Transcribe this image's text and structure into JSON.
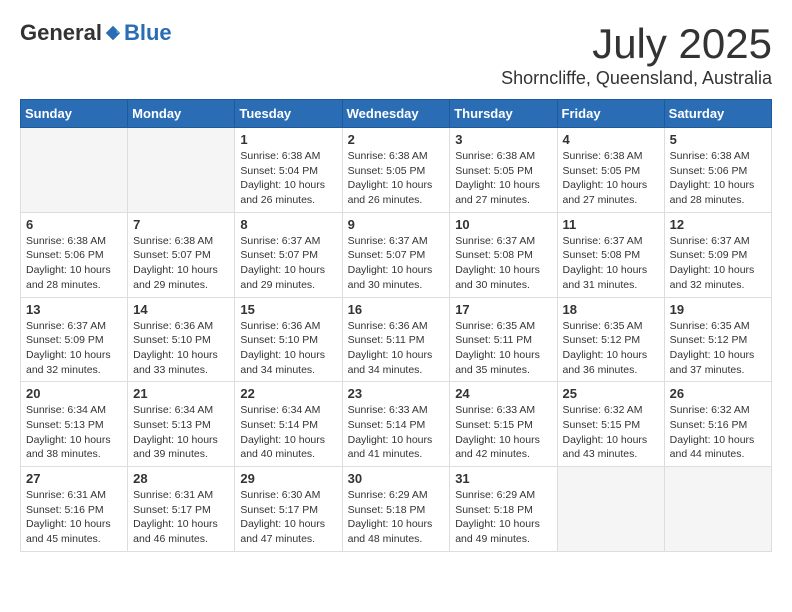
{
  "logo": {
    "general": "General",
    "blue": "Blue"
  },
  "header": {
    "month": "July 2025",
    "location": "Shorncliffe, Queensland, Australia"
  },
  "weekdays": [
    "Sunday",
    "Monday",
    "Tuesday",
    "Wednesday",
    "Thursday",
    "Friday",
    "Saturday"
  ],
  "weeks": [
    [
      {
        "day": "",
        "info": ""
      },
      {
        "day": "",
        "info": ""
      },
      {
        "day": "1",
        "info": "Sunrise: 6:38 AM\nSunset: 5:04 PM\nDaylight: 10 hours and 26 minutes."
      },
      {
        "day": "2",
        "info": "Sunrise: 6:38 AM\nSunset: 5:05 PM\nDaylight: 10 hours and 26 minutes."
      },
      {
        "day": "3",
        "info": "Sunrise: 6:38 AM\nSunset: 5:05 PM\nDaylight: 10 hours and 27 minutes."
      },
      {
        "day": "4",
        "info": "Sunrise: 6:38 AM\nSunset: 5:05 PM\nDaylight: 10 hours and 27 minutes."
      },
      {
        "day": "5",
        "info": "Sunrise: 6:38 AM\nSunset: 5:06 PM\nDaylight: 10 hours and 28 minutes."
      }
    ],
    [
      {
        "day": "6",
        "info": "Sunrise: 6:38 AM\nSunset: 5:06 PM\nDaylight: 10 hours and 28 minutes."
      },
      {
        "day": "7",
        "info": "Sunrise: 6:38 AM\nSunset: 5:07 PM\nDaylight: 10 hours and 29 minutes."
      },
      {
        "day": "8",
        "info": "Sunrise: 6:37 AM\nSunset: 5:07 PM\nDaylight: 10 hours and 29 minutes."
      },
      {
        "day": "9",
        "info": "Sunrise: 6:37 AM\nSunset: 5:07 PM\nDaylight: 10 hours and 30 minutes."
      },
      {
        "day": "10",
        "info": "Sunrise: 6:37 AM\nSunset: 5:08 PM\nDaylight: 10 hours and 30 minutes."
      },
      {
        "day": "11",
        "info": "Sunrise: 6:37 AM\nSunset: 5:08 PM\nDaylight: 10 hours and 31 minutes."
      },
      {
        "day": "12",
        "info": "Sunrise: 6:37 AM\nSunset: 5:09 PM\nDaylight: 10 hours and 32 minutes."
      }
    ],
    [
      {
        "day": "13",
        "info": "Sunrise: 6:37 AM\nSunset: 5:09 PM\nDaylight: 10 hours and 32 minutes."
      },
      {
        "day": "14",
        "info": "Sunrise: 6:36 AM\nSunset: 5:10 PM\nDaylight: 10 hours and 33 minutes."
      },
      {
        "day": "15",
        "info": "Sunrise: 6:36 AM\nSunset: 5:10 PM\nDaylight: 10 hours and 34 minutes."
      },
      {
        "day": "16",
        "info": "Sunrise: 6:36 AM\nSunset: 5:11 PM\nDaylight: 10 hours and 34 minutes."
      },
      {
        "day": "17",
        "info": "Sunrise: 6:35 AM\nSunset: 5:11 PM\nDaylight: 10 hours and 35 minutes."
      },
      {
        "day": "18",
        "info": "Sunrise: 6:35 AM\nSunset: 5:12 PM\nDaylight: 10 hours and 36 minutes."
      },
      {
        "day": "19",
        "info": "Sunrise: 6:35 AM\nSunset: 5:12 PM\nDaylight: 10 hours and 37 minutes."
      }
    ],
    [
      {
        "day": "20",
        "info": "Sunrise: 6:34 AM\nSunset: 5:13 PM\nDaylight: 10 hours and 38 minutes."
      },
      {
        "day": "21",
        "info": "Sunrise: 6:34 AM\nSunset: 5:13 PM\nDaylight: 10 hours and 39 minutes."
      },
      {
        "day": "22",
        "info": "Sunrise: 6:34 AM\nSunset: 5:14 PM\nDaylight: 10 hours and 40 minutes."
      },
      {
        "day": "23",
        "info": "Sunrise: 6:33 AM\nSunset: 5:14 PM\nDaylight: 10 hours and 41 minutes."
      },
      {
        "day": "24",
        "info": "Sunrise: 6:33 AM\nSunset: 5:15 PM\nDaylight: 10 hours and 42 minutes."
      },
      {
        "day": "25",
        "info": "Sunrise: 6:32 AM\nSunset: 5:15 PM\nDaylight: 10 hours and 43 minutes."
      },
      {
        "day": "26",
        "info": "Sunrise: 6:32 AM\nSunset: 5:16 PM\nDaylight: 10 hours and 44 minutes."
      }
    ],
    [
      {
        "day": "27",
        "info": "Sunrise: 6:31 AM\nSunset: 5:16 PM\nDaylight: 10 hours and 45 minutes."
      },
      {
        "day": "28",
        "info": "Sunrise: 6:31 AM\nSunset: 5:17 PM\nDaylight: 10 hours and 46 minutes."
      },
      {
        "day": "29",
        "info": "Sunrise: 6:30 AM\nSunset: 5:17 PM\nDaylight: 10 hours and 47 minutes."
      },
      {
        "day": "30",
        "info": "Sunrise: 6:29 AM\nSunset: 5:18 PM\nDaylight: 10 hours and 48 minutes."
      },
      {
        "day": "31",
        "info": "Sunrise: 6:29 AM\nSunset: 5:18 PM\nDaylight: 10 hours and 49 minutes."
      },
      {
        "day": "",
        "info": ""
      },
      {
        "day": "",
        "info": ""
      }
    ]
  ]
}
